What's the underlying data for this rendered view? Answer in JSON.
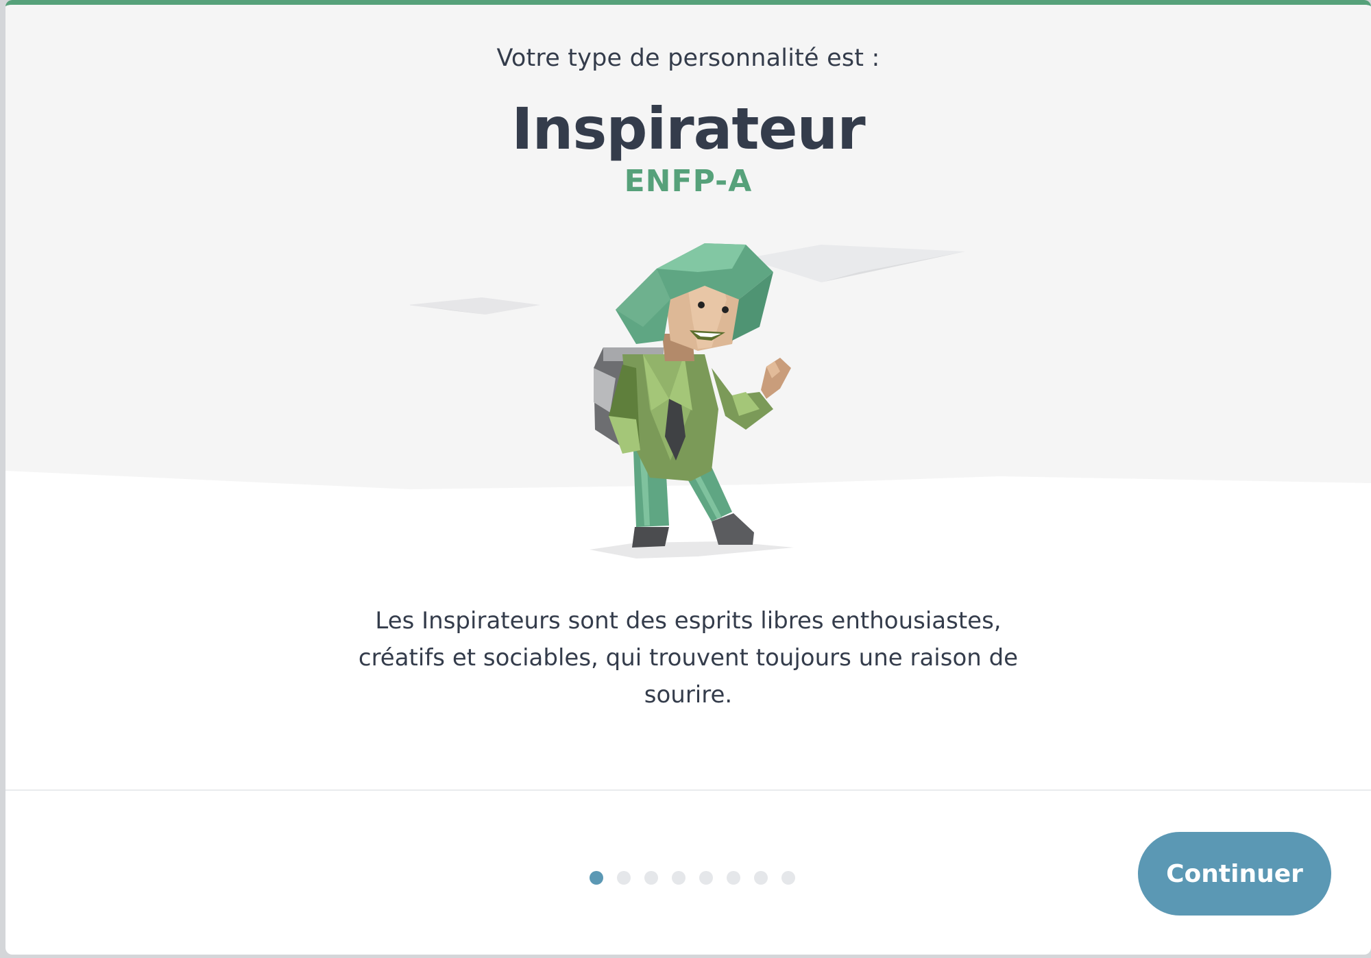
{
  "modal": {
    "intro": "Votre type de personnalité est :",
    "type_name": "Inspirateur",
    "type_code": "ENFP-A",
    "description": "Les Inspirateurs sont des esprits libres enthousiastes, créatifs et sociables, qui trouvent toujours une raison de sourire.",
    "illustration_icon": "explorer-character-icon"
  },
  "pager": {
    "total": 8,
    "active_index": 0
  },
  "footer": {
    "continue_label": "Continuer"
  },
  "colors": {
    "accent_green": "#56a17a",
    "button_blue": "#5b98b4",
    "text_dark": "#343c4b"
  }
}
